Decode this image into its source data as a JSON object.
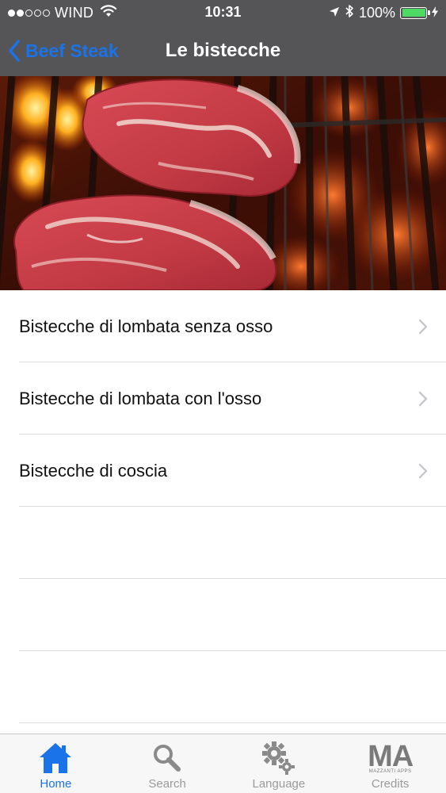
{
  "status_bar": {
    "signal_bars_filled": 2,
    "signal_bars_total": 5,
    "carrier": "WIND",
    "wifi_icon": "wifi-icon",
    "time": "10:31",
    "location_icon": "location-arrow-icon",
    "bluetooth_icon": "bluetooth-icon",
    "battery_percent": "100%",
    "battery_level": 1.0,
    "charging_icon": "bolt-icon"
  },
  "nav": {
    "back_label": "Beef Steak",
    "title": "Le bistecche"
  },
  "hero": {
    "image_icon": "grilled-steaks-image"
  },
  "list": {
    "items": [
      {
        "label": "Bistecche di lombata senza osso"
      },
      {
        "label": "Bistecche di lombata con l'osso"
      },
      {
        "label": "Bistecche di coscia"
      }
    ],
    "empty_rows": 3
  },
  "tabs": [
    {
      "label": "Home",
      "icon": "home-icon",
      "active": true
    },
    {
      "label": "Search",
      "icon": "search-icon",
      "active": false
    },
    {
      "label": "Language",
      "icon": "gears-icon",
      "active": false
    },
    {
      "label": "Credits",
      "icon": "ma-logo-icon",
      "logo_text": "MA",
      "logo_sub": "MAZZANTI APPS",
      "active": false
    }
  ],
  "colors": {
    "bar_background": "#555557",
    "accent": "#1a73e8",
    "battery": "#4cd964",
    "inactive_tab": "#9a9a9a"
  }
}
